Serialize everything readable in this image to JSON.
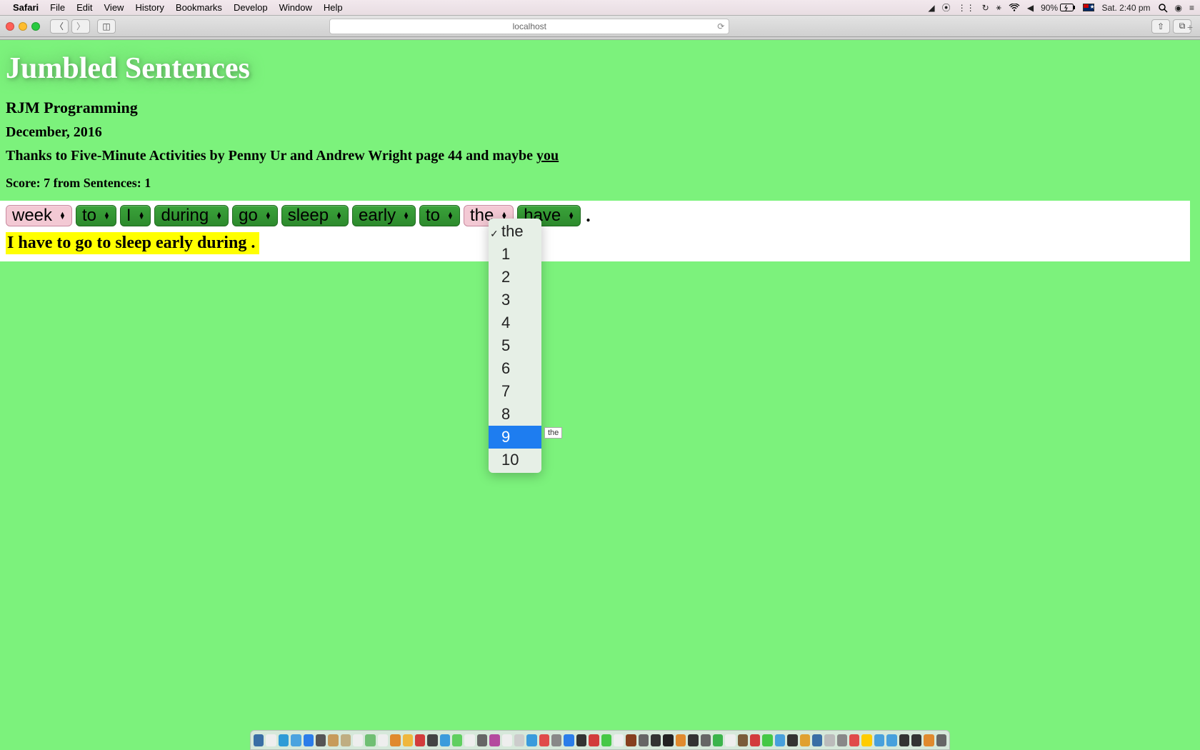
{
  "menubar": {
    "app": "Safari",
    "items": [
      "File",
      "Edit",
      "View",
      "History",
      "Bookmarks",
      "Develop",
      "Window",
      "Help"
    ],
    "battery": "90%",
    "clock": "Sat. 2:40 pm"
  },
  "toolbar": {
    "address": "localhost"
  },
  "page": {
    "title": "Jumbled Sentences",
    "subtitle1": "RJM Programming",
    "subtitle2": "December, 2016",
    "thanks_prefix": "Thanks to Five-Minute Activities by Penny Ur and Andrew Wright page 44 and maybe ",
    "thanks_link": "you",
    "score_line": "Score: 7 from Sentences: 1",
    "words": [
      {
        "text": "week",
        "style": "pink"
      },
      {
        "text": "to",
        "style": "green"
      },
      {
        "text": "I",
        "style": "green"
      },
      {
        "text": "during",
        "style": "green"
      },
      {
        "text": "go",
        "style": "green"
      },
      {
        "text": "sleep",
        "style": "green"
      },
      {
        "text": "early",
        "style": "green"
      },
      {
        "text": "to",
        "style": "green"
      },
      {
        "text": "the",
        "style": "pink"
      },
      {
        "text": "have",
        "style": "green"
      }
    ],
    "period": ".",
    "answer": "I have to go to sleep early during  .",
    "dropdown": {
      "current": "the",
      "options": [
        "the",
        "1",
        "2",
        "3",
        "4",
        "5",
        "6",
        "7",
        "8",
        "9",
        "10"
      ],
      "highlighted_index": 9
    },
    "tooltip": "the"
  },
  "dock_colors": [
    "#3a6ea5",
    "#eee",
    "#2e9bd6",
    "#4aa3df",
    "#2b7de9",
    "#555",
    "#c79b5a",
    "#bfae82",
    "#eee",
    "#6fbf73",
    "#eee",
    "#e08a2e",
    "#efb73e",
    "#d23c3c",
    "#444",
    "#3a9bdc",
    "#5fcf5f",
    "#eee",
    "#666",
    "#b44b9e",
    "#eee",
    "#ccc",
    "#3a9bdc",
    "#e04b4b",
    "#888",
    "#2b7de9",
    "#333",
    "#d23c3c",
    "#46c846",
    "#eee",
    "#863f1e",
    "#666",
    "#333",
    "#222",
    "#e08a2e",
    "#333",
    "#666",
    "#3bb44b",
    "#eee",
    "#7a5c3a",
    "#d23c3c",
    "#46c846",
    "#48a0dc",
    "#333",
    "#e0a030",
    "#3a6ea5",
    "#bbb",
    "#888",
    "#e04b4b",
    "#ffcc00",
    "#48a0dc",
    "#48a0dc",
    "#333",
    "#333",
    "#e08a2e",
    "#666"
  ]
}
